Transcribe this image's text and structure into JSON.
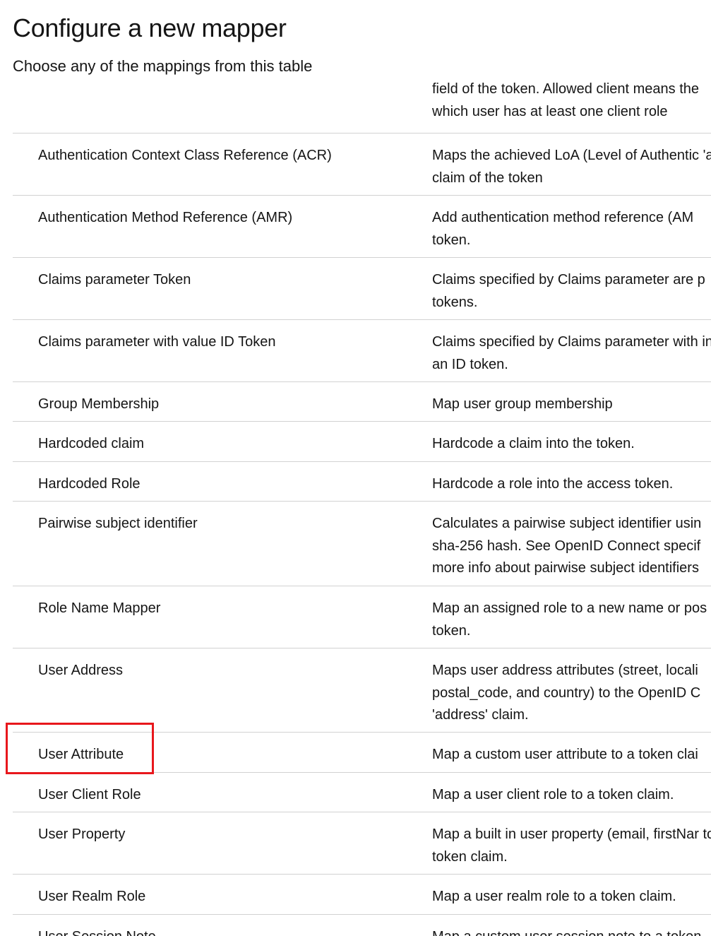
{
  "modal": {
    "title": "Configure a new mapper",
    "subtitle": "Choose any of the mappings from this table"
  },
  "table": {
    "partial_first_row": {
      "description": "field of the token. Allowed client means the which user has at least one client role"
    },
    "rows": [
      {
        "name": "Authentication Context Class Reference (ACR)",
        "description": "Maps the achieved LoA (Level of Authentic 'acr' claim of the token"
      },
      {
        "name": "Authentication Method Reference (AMR)",
        "description": "Add authentication method reference (AM token."
      },
      {
        "name": "Claims parameter Token",
        "description": "Claims specified by Claims parameter are p tokens."
      },
      {
        "name": "Claims parameter with value ID Token",
        "description": "Claims specified by Claims parameter with into an ID token."
      },
      {
        "name": "Group Membership",
        "description": "Map user group membership"
      },
      {
        "name": "Hardcoded claim",
        "description": "Hardcode a claim into the token."
      },
      {
        "name": "Hardcoded Role",
        "description": "Hardcode a role into the access token."
      },
      {
        "name": "Pairwise subject identifier",
        "description": "Calculates a pairwise subject identifier usin sha-256 hash. See OpenID Connect specif more info about pairwise subject identifiers"
      },
      {
        "name": "Role Name Mapper",
        "description": "Map an assigned role to a new name or pos token."
      },
      {
        "name": "User Address",
        "description": "Maps user address attributes (street, locali postal_code, and country) to the OpenID C 'address' claim."
      },
      {
        "name": "User Attribute",
        "description": "Map a custom user attribute to a token clai"
      },
      {
        "name": "User Client Role",
        "description": "Map a user client role to a token claim."
      },
      {
        "name": "User Property",
        "description": "Map a built in user property (email, firstNar to a token claim."
      },
      {
        "name": "User Realm Role",
        "description": "Map a user realm role to a token claim."
      },
      {
        "name": "User Session Note",
        "description": "Map a custom user session note to a token"
      }
    ]
  },
  "highlight": {
    "color": "#e8171c",
    "target": "User Attribute"
  }
}
